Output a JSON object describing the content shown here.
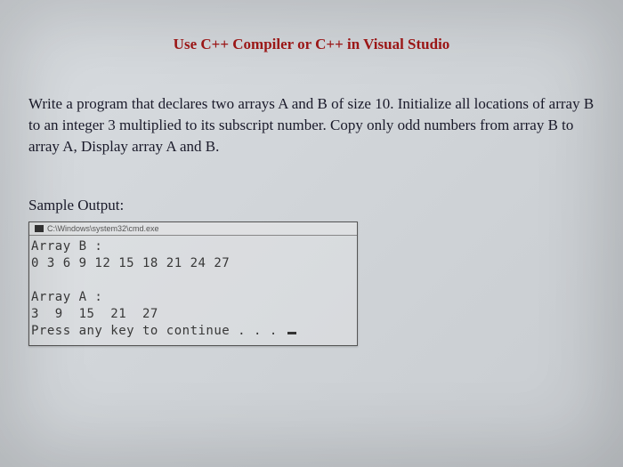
{
  "title": "Use C++ Compiler or C++ in Visual Studio",
  "problem": "Write a program that declares two arrays A and B of size 10. Initialize all locations of array B to an integer 3 multiplied to its subscript number. Copy only odd numbers from array B to array A, Display array A and B.",
  "sampleLabel": "Sample Output:",
  "console": {
    "titlebarPath": "C:\\Windows\\system32\\cmd.exe",
    "lines": {
      "l1": "Array B :",
      "l2": "0 3 6 9 12 15 18 21 24 27",
      "l3": "",
      "l4": "Array A :",
      "l5": "3  9  15  21  27",
      "l6": "Press any key to continue . . . "
    }
  },
  "arrays": {
    "B": [
      0,
      3,
      6,
      9,
      12,
      15,
      18,
      21,
      24,
      27
    ],
    "A": [
      3,
      9,
      15,
      21,
      27
    ]
  }
}
